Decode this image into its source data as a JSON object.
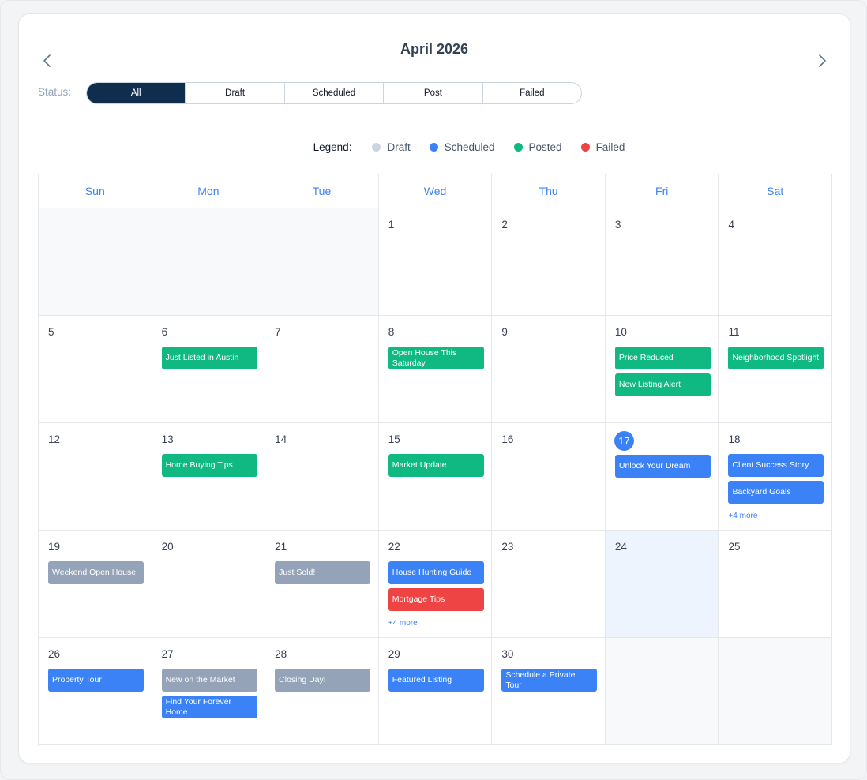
{
  "calendar": {
    "title": "April 2026",
    "status_label": "Status:",
    "filters": [
      {
        "label": "All",
        "active": true
      },
      {
        "label": "Draft",
        "active": false
      },
      {
        "label": "Scheduled",
        "active": false
      },
      {
        "label": "Post",
        "active": false
      },
      {
        "label": "Failed",
        "active": false
      }
    ],
    "legend": {
      "title": "Legend:",
      "items": [
        {
          "label": "Draft",
          "color": "#cbd5e1"
        },
        {
          "label": "Scheduled",
          "color": "#3b82f6"
        },
        {
          "label": "Posted",
          "color": "#10b981"
        },
        {
          "label": "Failed",
          "color": "#ef4444"
        }
      ]
    },
    "weekdays": [
      "Sun",
      "Mon",
      "Tue",
      "Wed",
      "Thu",
      "Fri",
      "Sat"
    ],
    "today": 17,
    "status_colors": {
      "posted": "#10b981",
      "scheduled": "#3b82f6",
      "draft": "#94a3b8",
      "failed": "#ef4444"
    },
    "weeks": [
      [
        {
          "empty": true
        },
        {
          "empty": true
        },
        {
          "empty": true
        },
        {
          "day": "1",
          "events": []
        },
        {
          "day": "2",
          "events": []
        },
        {
          "day": "3",
          "events": []
        },
        {
          "day": "4",
          "events": []
        }
      ],
      [
        {
          "day": "5",
          "events": []
        },
        {
          "day": "6",
          "events": [
            {
              "title": "Just Listed in Austin",
              "status": "posted"
            }
          ]
        },
        {
          "day": "7",
          "events": []
        },
        {
          "day": "8",
          "events": [
            {
              "title": "Open House This Saturday",
              "status": "posted"
            }
          ]
        },
        {
          "day": "9",
          "events": []
        },
        {
          "day": "10",
          "events": [
            {
              "title": "Price Reduced",
              "status": "posted"
            },
            {
              "title": "New Listing Alert",
              "status": "posted"
            }
          ]
        },
        {
          "day": "11",
          "events": [
            {
              "title": "Neighborhood Spotlight",
              "status": "posted"
            }
          ]
        }
      ],
      [
        {
          "day": "12",
          "events": []
        },
        {
          "day": "13",
          "events": [
            {
              "title": "Home Buying Tips",
              "status": "posted"
            }
          ]
        },
        {
          "day": "14",
          "events": []
        },
        {
          "day": "15",
          "events": [
            {
              "title": "Market Update",
              "status": "posted"
            }
          ]
        },
        {
          "day": "16",
          "events": []
        },
        {
          "day": "17",
          "today": true,
          "events": [
            {
              "title": "Unlock Your Dream",
              "status": "scheduled"
            }
          ]
        },
        {
          "day": "18",
          "events": [
            {
              "title": "Client Success Story",
              "status": "scheduled"
            },
            {
              "title": "Backyard Goals",
              "status": "scheduled"
            }
          ],
          "more": "+4 more"
        }
      ],
      [
        {
          "day": "19",
          "events": [
            {
              "title": "Weekend Open House",
              "status": "draft"
            }
          ]
        },
        {
          "day": "20",
          "events": []
        },
        {
          "day": "21",
          "events": [
            {
              "title": "Just Sold!",
              "status": "draft"
            }
          ]
        },
        {
          "day": "22",
          "events": [
            {
              "title": "House Hunting Guide",
              "status": "scheduled"
            },
            {
              "title": "Mortgage Tips",
              "status": "failed"
            }
          ],
          "more": "+4 more"
        },
        {
          "day": "23",
          "events": []
        },
        {
          "day": "24",
          "highlight": true,
          "events": []
        },
        {
          "day": "25",
          "events": []
        }
      ],
      [
        {
          "day": "26",
          "events": [
            {
              "title": "Property Tour",
              "status": "scheduled"
            }
          ]
        },
        {
          "day": "27",
          "events": [
            {
              "title": "New on the Market",
              "status": "draft"
            },
            {
              "title": "Find Your Forever Home",
              "status": "scheduled"
            }
          ]
        },
        {
          "day": "28",
          "events": [
            {
              "title": "Closing Day!",
              "status": "draft"
            }
          ]
        },
        {
          "day": "29",
          "events": [
            {
              "title": "Featured Listing",
              "status": "scheduled"
            }
          ]
        },
        {
          "day": "30",
          "events": [
            {
              "title": "Schedule a Private Tour",
              "status": "scheduled"
            }
          ]
        },
        {
          "empty": true
        },
        {
          "empty": true
        }
      ]
    ]
  }
}
